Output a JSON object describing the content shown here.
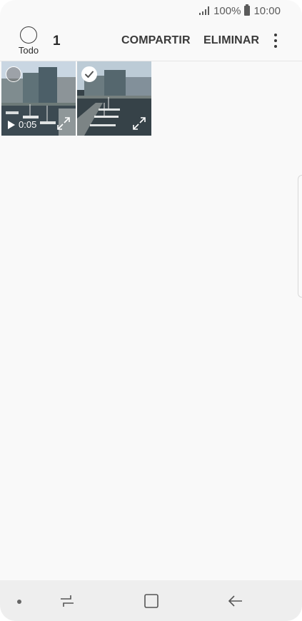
{
  "status_bar": {
    "battery": "100%",
    "time": "10:00"
  },
  "action_bar": {
    "select_all_label": "Todo",
    "selected_count": "1",
    "share_label": "COMPARTIR",
    "delete_label": "ELIMINAR"
  },
  "items": [
    {
      "kind": "video",
      "duration": "0:05",
      "selected": false
    },
    {
      "kind": "photo",
      "selected": true
    }
  ],
  "icons": {
    "signal": "signal-icon",
    "battery": "battery-icon",
    "more": "more-vertical-icon",
    "play": "play-icon",
    "expand": "expand-icon",
    "check": "check-icon",
    "recents": "recents-icon",
    "home": "home-icon",
    "back": "back-icon"
  },
  "colors": {
    "background": "#f9f9f9",
    "text": "#3a3a3a",
    "nav_bar": "#eeeeee"
  }
}
